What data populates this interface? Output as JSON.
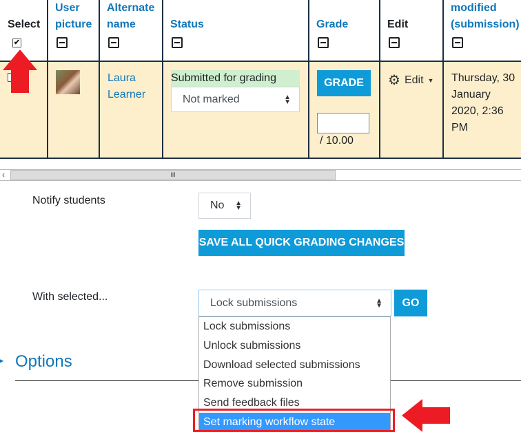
{
  "table": {
    "headers": [
      {
        "label": "Select",
        "link": false
      },
      {
        "label": "User picture",
        "link": true
      },
      {
        "label": "Alternate name",
        "link": true
      },
      {
        "label": "Status",
        "link": true
      },
      {
        "label": "Grade",
        "link": true
      },
      {
        "label": "Edit",
        "link": false
      },
      {
        "label": "modified (submission)",
        "link": true
      }
    ],
    "row": {
      "name_first": "Laura",
      "name_last": "Learner",
      "status": "Submitted for grading",
      "marking_select": "Not marked",
      "grade_button": "GRADE",
      "grade_value": "",
      "grade_max": "/ 10.00",
      "edit_label": "Edit",
      "modified_lines": [
        "Thursday, 30",
        "January",
        "2020, 2:36",
        "PM"
      ]
    }
  },
  "notify": {
    "label": "Notify students",
    "value": "No"
  },
  "save_button": "SAVE ALL QUICK GRADING CHANGES",
  "with_selected": {
    "label": "With selected...",
    "value": "Lock submissions",
    "go": "GO",
    "options": [
      "Lock submissions",
      "Unlock submissions",
      "Download selected submissions",
      "Remove submission",
      "Send feedback files",
      "Set marking workflow state"
    ],
    "highlighted": "Set marking workflow state"
  },
  "options_heading": "Options",
  "colors": {
    "accent": "#0f9ad8",
    "row_bg": "#fdefcc",
    "status_bg": "#cfefcf",
    "highlight": "#3399ff",
    "annotation": "#ed1c24"
  }
}
